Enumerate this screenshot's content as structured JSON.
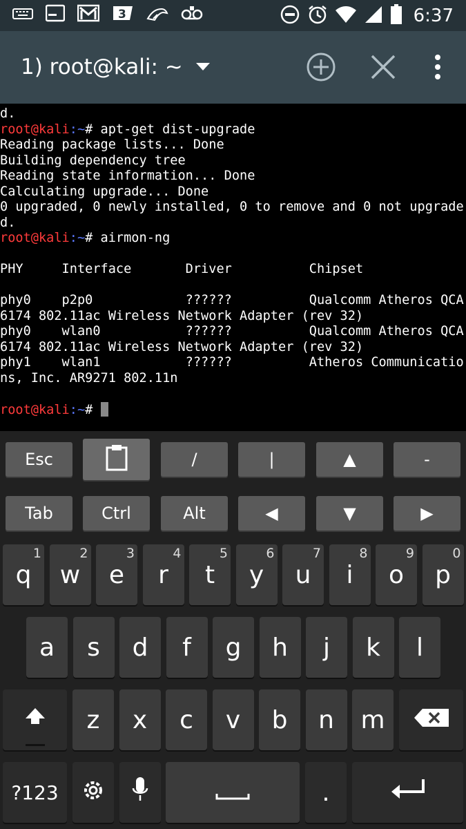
{
  "status_bar": {
    "time": "6:37",
    "left_icons": [
      "keyboard-icon",
      "terminal-icon",
      "gmail-icon",
      "three-icon",
      "bird-icon",
      "voicemail-icon"
    ],
    "right_icons": [
      "do-not-disturb-icon",
      "alarm-icon",
      "wifi-icon",
      "signal-icon",
      "battery-icon"
    ]
  },
  "toolbar": {
    "title": "1) root@kali: ~",
    "icons": [
      "dropdown-icon",
      "add-session-icon",
      "close-session-icon",
      "overflow-menu-icon"
    ]
  },
  "terminal": {
    "lines": [
      {
        "text": "d."
      },
      {
        "user": "root@kali",
        "path": ":~",
        "cmd": "# apt-get dist-upgrade"
      },
      {
        "text": "Reading package lists... Done"
      },
      {
        "text": "Building dependency tree"
      },
      {
        "text": "Reading state information... Done"
      },
      {
        "text": "Calculating upgrade... Done"
      },
      {
        "text": "0 upgraded, 0 newly installed, 0 to remove and 0 not upgrade"
      },
      {
        "text": "d."
      },
      {
        "user": "root@kali",
        "path": ":~",
        "cmd": "# airmon-ng"
      },
      {
        "text": ""
      },
      {
        "text": "PHY     Interface       Driver          Chipset"
      },
      {
        "text": ""
      },
      {
        "text": "phy0    p2p0            ??????          Qualcomm Atheros QCA"
      },
      {
        "text": "6174 802.11ac Wireless Network Adapter (rev 32)"
      },
      {
        "text": "phy0    wlan0           ??????          Qualcomm Atheros QCA"
      },
      {
        "text": "6174 802.11ac Wireless Network Adapter (rev 32)"
      },
      {
        "text": "phy1    wlan1           ??????          Atheros Communicatio"
      },
      {
        "text": "ns, Inc. AR9271 802.11n"
      },
      {
        "text": ""
      },
      {
        "user": "root@kali",
        "path": ":~",
        "cmd": "# ",
        "cursor": true
      }
    ]
  },
  "extra_keys": {
    "row1": [
      {
        "label": "Esc",
        "name": "esc-key"
      },
      {
        "label": "",
        "name": "clipboard-key",
        "icon": "clipboard-icon"
      },
      {
        "label": "/",
        "name": "slash-key"
      },
      {
        "label": "|",
        "name": "pipe-key"
      },
      {
        "label": "▲",
        "name": "arrow-up-key"
      },
      {
        "label": "-",
        "name": "dash-key"
      }
    ],
    "row2": [
      {
        "label": "Tab",
        "name": "tab-key"
      },
      {
        "label": "Ctrl",
        "name": "ctrl-key"
      },
      {
        "label": "Alt",
        "name": "alt-key"
      },
      {
        "label": "◀",
        "name": "arrow-left-key"
      },
      {
        "label": "▼",
        "name": "arrow-down-key"
      },
      {
        "label": "▶",
        "name": "arrow-right-key"
      }
    ]
  },
  "keyboard": {
    "row1": [
      {
        "label": "q",
        "hint": "1"
      },
      {
        "label": "w",
        "hint": "2"
      },
      {
        "label": "e",
        "hint": "3"
      },
      {
        "label": "r",
        "hint": "4"
      },
      {
        "label": "t",
        "hint": "5"
      },
      {
        "label": "y",
        "hint": "6"
      },
      {
        "label": "u",
        "hint": "7"
      },
      {
        "label": "i",
        "hint": "8"
      },
      {
        "label": "o",
        "hint": "9"
      },
      {
        "label": "p",
        "hint": "0"
      }
    ],
    "row2": [
      "a",
      "s",
      "d",
      "f",
      "g",
      "h",
      "j",
      "k",
      "l"
    ],
    "row3": [
      "z",
      "x",
      "c",
      "v",
      "b",
      "n",
      "m"
    ],
    "symbols_label": "?123",
    "period_label": "."
  }
}
